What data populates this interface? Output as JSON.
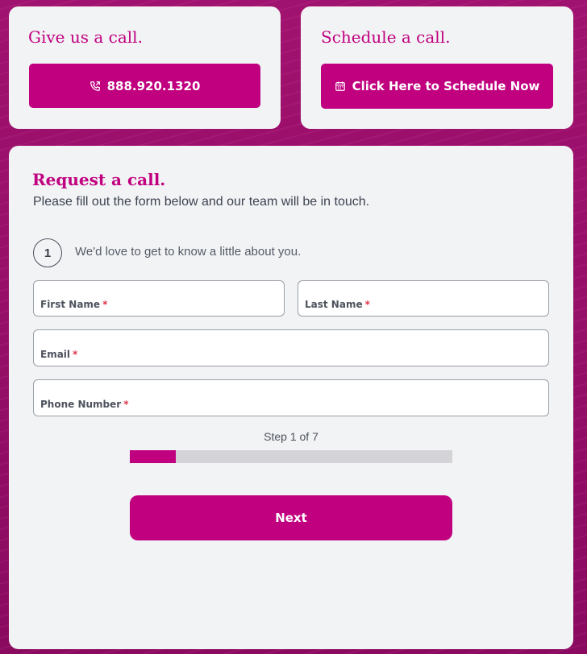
{
  "call_card": {
    "title": "Give us a call.",
    "phone_label": "888.920.1320",
    "icon": "phone-icon"
  },
  "schedule_card": {
    "title": "Schedule a call.",
    "button_label": "Click Here to Schedule Now",
    "icon": "calendar-icon"
  },
  "form": {
    "title": "Request a call.",
    "subtitle": "Please fill out the form below and our team will be in touch.",
    "step_number": "1",
    "step_intro": "We'd love to get to know a little about you.",
    "fields": {
      "first_name": {
        "label": "First Name",
        "required_mark": "*",
        "value": ""
      },
      "last_name": {
        "label": "Last Name",
        "required_mark": "*",
        "value": ""
      },
      "email": {
        "label": "Email",
        "required_mark": "*",
        "value": ""
      },
      "phone": {
        "label": "Phone Number",
        "required_mark": "*",
        "value": ""
      }
    },
    "progress": {
      "label": "Step 1 of 7",
      "current": 1,
      "total": 7
    },
    "next_label": "Next"
  },
  "colors": {
    "accent": "#c0007f",
    "background": "#8e0a67",
    "card": "#f2f3f5",
    "required": "#e0334a"
  }
}
